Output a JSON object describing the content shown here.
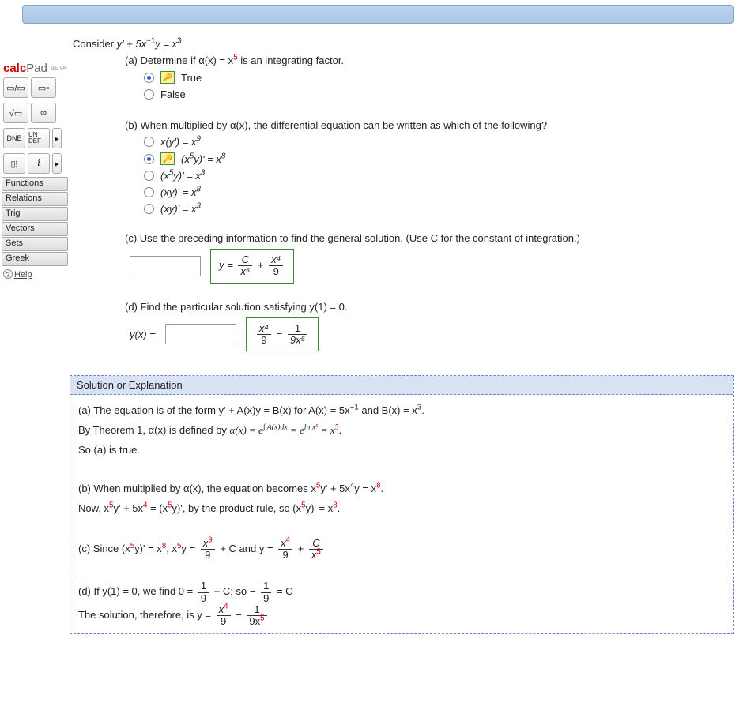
{
  "sidebar": {
    "brand_calc": "calc",
    "brand_pad": "Pad",
    "beta": "BETA",
    "row1": [
      "▭/▭",
      "▭▫"
    ],
    "row2": [
      "√▭",
      "∞"
    ],
    "row3": [
      "DNE",
      "UN DEF",
      "▸"
    ],
    "row4": [
      "▯!",
      "i",
      "▸"
    ],
    "cats": [
      "Functions",
      "Relations",
      "Trig",
      "Vectors",
      "Sets",
      "Greek"
    ],
    "help": "Help"
  },
  "question": {
    "stem_pre": "Consider  ",
    "stem_eq_a": "y' + 5x",
    "stem_eq_b": "y = x",
    "part_a_text": "(a) Determine if  α(x) = x",
    "part_a_text2": "  is an integrating factor.",
    "opt_true": "True",
    "opt_false": "False",
    "part_b_text": "(b) When multiplied by  α(x),  the differential equation can be written as which of the following?",
    "b_opt1_a": "x(y') = x",
    "b_opt2_a": "(x",
    "b_opt2_b": "y)' = x",
    "b_opt3_a": "(x",
    "b_opt3_b": "y)' = x",
    "b_opt4_a": "(xy)' = x",
    "b_opt5_a": "(xy)' = x",
    "part_c_text": "(c) Use the preceding information to find the general solution. (Use C for the constant of integration.)",
    "c_ans_lead": "y = ",
    "c_num1": "C",
    "c_den1": "x⁵",
    "c_plus": "+",
    "c_num2": "x⁴",
    "c_den2": "9",
    "part_d_text": "(d) Find the particular solution satisfying  y(1) = 0.",
    "d_lead": "y(x) = ",
    "d_num1": "x⁴",
    "d_den1": "9",
    "d_minus": "−",
    "d_num2": "1",
    "d_den2": "9x⁵"
  },
  "solution": {
    "header": "Solution or Explanation",
    "a1_pre": "(a) The equation is of the form  y' + A(x)y = B(x)  for  A(x) = 5x",
    "a1_mid": "  and  B(x) = x",
    "a1_post": ".",
    "a2_pre": "By Theorem 1,  α(x)  is defined by  ",
    "a2_img": "α(x) = e∫ A(x)dx = eln x⁵ = x⁵",
    "a3": "So (a) is true.",
    "b1_pre": "(b) When multiplied by  α(x),  the equation becomes  x",
    "b1_mid1": "y' + 5x",
    "b1_mid2": "y = x",
    "b1_post": ".",
    "b2_pre": "Now,  x",
    "b2_mid1": "y' + 5x",
    "b2_mid2": " = (x",
    "b2_mid3": "y)',  by the product rule, so  (x",
    "b2_mid4": "y)' = x",
    "b2_post": ".",
    "c1_pre": "(c) Since  (x",
    "c1_mid1": "y)' = x",
    "c1_mid2": ", x",
    "c1_mid3": "y = ",
    "c1_num1": "x",
    "c1_den1": "9",
    "c1_plus": " + C  and  y = ",
    "c1_num2": "x",
    "c1_den2": "9",
    "c1_plus2": " + ",
    "c1_num3": "C",
    "c1_den3": "x",
    "d1_pre": "(d) If  y(1) = 0,  we find  0 = ",
    "d1_num1": "1",
    "d1_den1": "9",
    "d1_mid": " + C;  so  − ",
    "d1_num2": "1",
    "d1_den2": "9",
    "d1_post": " = C",
    "d2_pre": "The solution, therefore, is  y = ",
    "d2_num1": "x",
    "d2_den1": "9",
    "d2_minus": " − ",
    "d2_num2": "1",
    "d2_den2": "9x"
  }
}
